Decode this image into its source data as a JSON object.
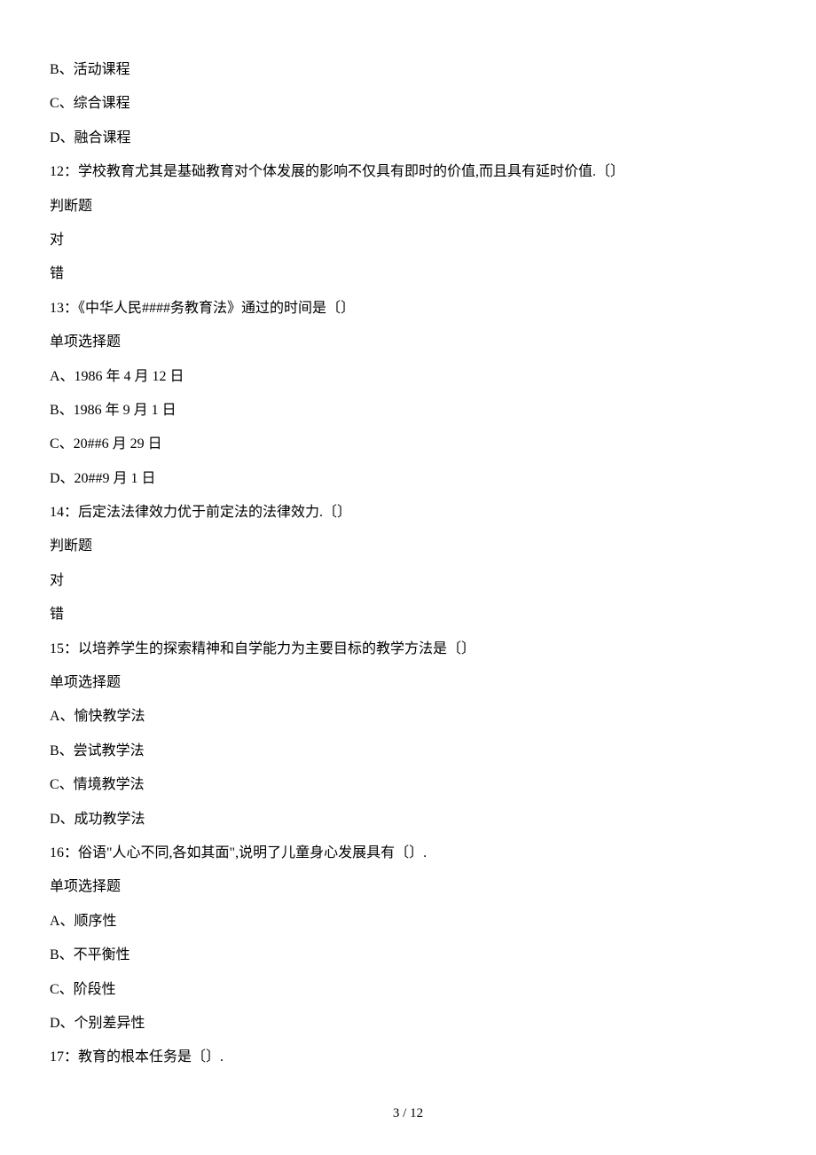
{
  "lines": {
    "q11_optB": "B、活动课程",
    "q11_optC": "C、综合课程",
    "q11_optD": "D、融合课程",
    "q12_stem": "12：学校教育尤其是基础教育对个体发展的影响不仅具有即时的价值,而且具有延时价值.〔〕",
    "q12_type": "判断题",
    "q12_true": "对",
    "q12_false": "错",
    "q13_stem": "13：《中华人民####务教育法》通过的时间是〔〕",
    "q13_type": "单项选择题",
    "q13_optA": "A、1986 年 4 月 12 日",
    "q13_optB": "B、1986 年 9 月 1 日",
    "q13_optC": "C、20##6 月 29 日",
    "q13_optD": "D、20##9 月 1 日",
    "q14_stem": "14：后定法法律效力优于前定法的法律效力.〔〕",
    "q14_type": "判断题",
    "q14_true": "对",
    "q14_false": "错",
    "q15_stem": "15：以培养学生的探索精神和自学能力为主要目标的教学方法是〔〕",
    "q15_type": "单项选择题",
    "q15_optA": "A、愉快教学法",
    "q15_optB": "B、尝试教学法",
    "q15_optC": "C、情境教学法",
    "q15_optD": "D、成功教学法",
    "q16_stem": "16：俗语\"人心不同,各如其面\",说明了儿童身心发展具有〔〕.",
    "q16_type": "单项选择题",
    "q16_optA": "A、顺序性",
    "q16_optB": "B、不平衡性",
    "q16_optC": "C、阶段性",
    "q16_optD": "D、个别差异性",
    "q17_stem": "17：教育的根本任务是〔〕."
  },
  "pageNumber": "3 / 12"
}
